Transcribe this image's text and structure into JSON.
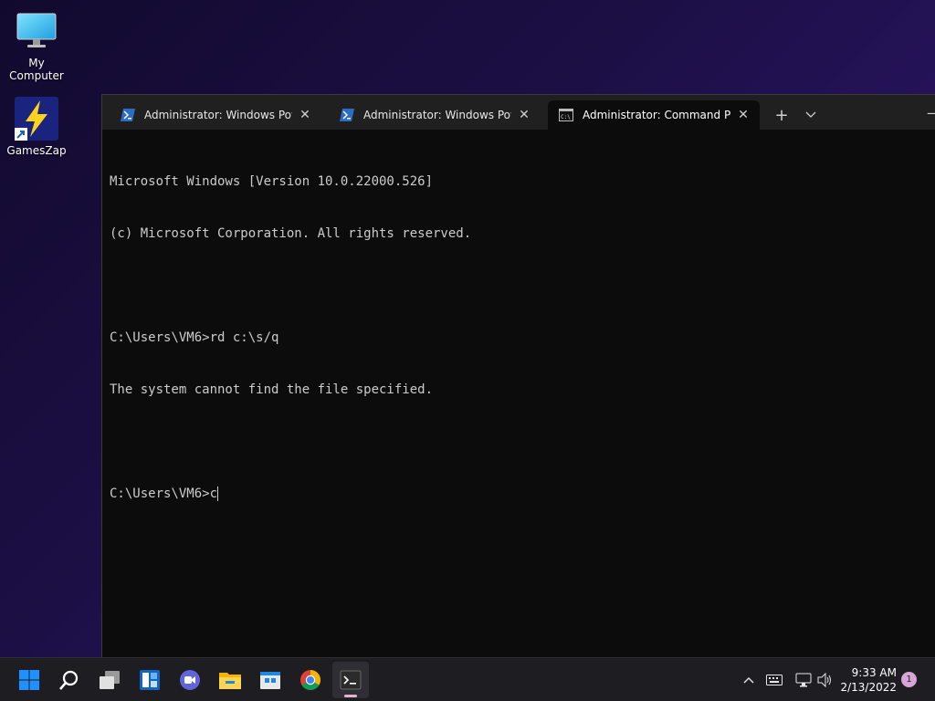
{
  "desktop": {
    "icons": [
      {
        "label": "My Computer",
        "icon": "monitor-icon"
      },
      {
        "label": "GamesZap",
        "icon": "lightning-icon"
      }
    ]
  },
  "terminal": {
    "tabs": [
      {
        "title": "Administrator: Windows PowerS",
        "icon": "powershell-icon",
        "active": false
      },
      {
        "title": "Administrator: Windows PowerS",
        "icon": "powershell-icon",
        "active": false
      },
      {
        "title": "Administrator: Command Promp",
        "icon": "cmd-icon",
        "active": true
      }
    ],
    "new_tab": "+",
    "dropdown": "⌵",
    "close_glyph": "✕",
    "lines": [
      "Microsoft Windows [Version 10.0.22000.526]",
      "(c) Microsoft Corporation. All rights reserved.",
      "",
      "C:\\Users\\VM6>rd c:\\s/q",
      "The system cannot find the file specified.",
      "",
      "C:\\Users\\VM6>c"
    ]
  },
  "taskbar": {
    "apps": [
      "start-icon",
      "search-icon",
      "task-view-icon",
      "widgets-icon",
      "teams-chat-icon",
      "file-explorer-icon",
      "store-icon",
      "chrome-icon",
      "terminal-icon"
    ],
    "clock_time": "9:33 AM",
    "clock_date": "2/13/2022",
    "notification_count": "1",
    "colors": {
      "accent": "#1e90ff",
      "terminal_bg": "#0c0c0c",
      "tab_bar": "#202020"
    }
  }
}
